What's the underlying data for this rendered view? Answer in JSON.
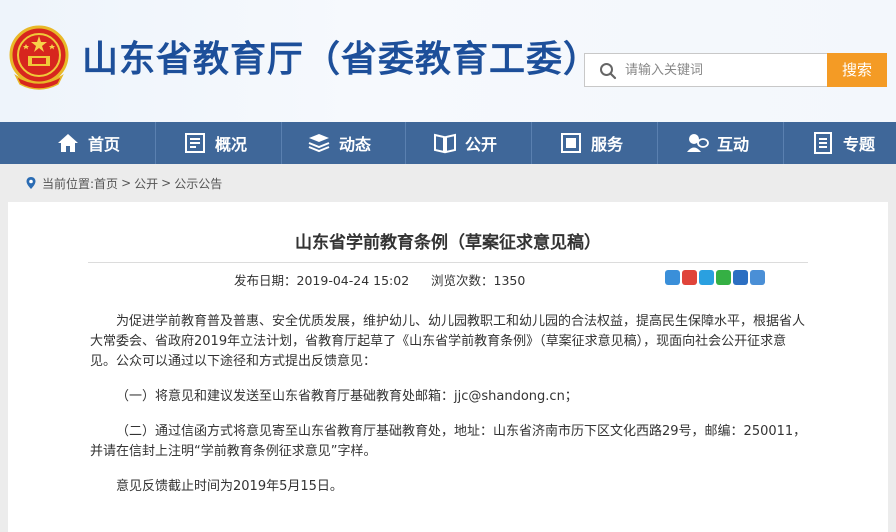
{
  "header": {
    "site_title": "山东省教育厅（省委教育工委）",
    "emblem_icon": "national-emblem-icon",
    "search": {
      "placeholder": "请输入关键词",
      "button_label": "搜索"
    }
  },
  "nav": {
    "items": [
      {
        "label": "首页",
        "icon": "home-icon"
      },
      {
        "label": "概况",
        "icon": "overview-icon"
      },
      {
        "label": "动态",
        "icon": "news-icon"
      },
      {
        "label": "公开",
        "icon": "book-icon"
      },
      {
        "label": "服务",
        "icon": "service-icon"
      },
      {
        "label": "互动",
        "icon": "chat-icon"
      },
      {
        "label": "专题",
        "icon": "topic-icon"
      }
    ]
  },
  "breadcrumb": {
    "prefix": "当前位置:",
    "items": [
      "首页",
      "公开",
      "公示公告"
    ],
    "separator": ">"
  },
  "article": {
    "title": "山东省学前教育条例（草案征求意见稿）",
    "date_label": "发布日期：",
    "date_value": "2019-04-24 15:02",
    "views_label": "浏览次数：",
    "views_value": "1350",
    "paragraphs": [
      "为促进学前教育普及普惠、安全优质发展，维护幼儿、幼儿园教职工和幼儿园的合法权益，提高民生保障水平，根据省人大常委会、省政府2019年立法计划，省教育厅起草了《山东省学前教育条例》（草案征求意见稿），现面向社会公开征求意见。公众可以通过以下途径和方式提出反馈意见：",
      "（一）将意见和建议发送至山东省教育厅基础教育处邮箱：jjc@shandong.cn；",
      "（二）通过信函方式将意见寄至山东省教育厅基础教育处，地址：山东省济南市历下区文化西路29号，邮编：250011，并请在信封上注明“学前教育条例征求意见”字样。",
      "意见反馈截止时间为2019年5月15日。"
    ]
  },
  "colors": {
    "nav_bg": "#3f6799",
    "title_blue": "#1d4f9a",
    "search_button": "#f49b25"
  }
}
